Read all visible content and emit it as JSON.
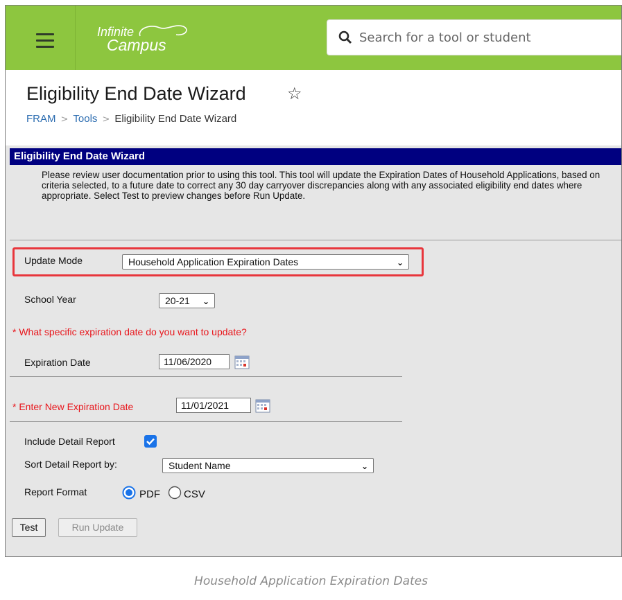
{
  "header": {
    "logo_line1": "Infinite",
    "logo_line2": "Campus",
    "search_placeholder": "Search for a tool or student",
    "accent_color": "#8dc63f"
  },
  "page": {
    "title": "Eligibility End Date Wizard",
    "breadcrumbs": [
      "FRAM",
      "Tools",
      "Eligibility End Date Wizard"
    ]
  },
  "wizard": {
    "title": "Eligibility End Date Wizard",
    "description": "Please review user documentation prior to using this tool. This tool will update the Expiration Dates of Household Applications, based on criteria selected, to a future date to correct any 30 day carryover discrepancies along with any associated eligibility end dates where appropriate. Select Test to preview changes before Run Update.",
    "update_mode_label": "Update Mode",
    "update_mode_value": "Household Application Expiration Dates",
    "school_year_label": "School Year",
    "school_year_value": "20-21",
    "question": "* What specific expiration date do you want to update?",
    "expiration_date_label": "Expiration Date",
    "expiration_date_value": "11/06/2020",
    "new_expiration_label": "* Enter New Expiration Date",
    "new_expiration_value": "11/01/2021",
    "include_detail_label": "Include Detail Report",
    "include_detail_checked": true,
    "sort_label": "Sort Detail Report by:",
    "sort_value": "Student Name",
    "report_format_label": "Report Format",
    "report_format_options": [
      "PDF",
      "CSV"
    ],
    "report_format_selected": "PDF",
    "test_button": "Test",
    "run_update_button": "Run Update"
  },
  "caption": "Household Application Expiration Dates"
}
